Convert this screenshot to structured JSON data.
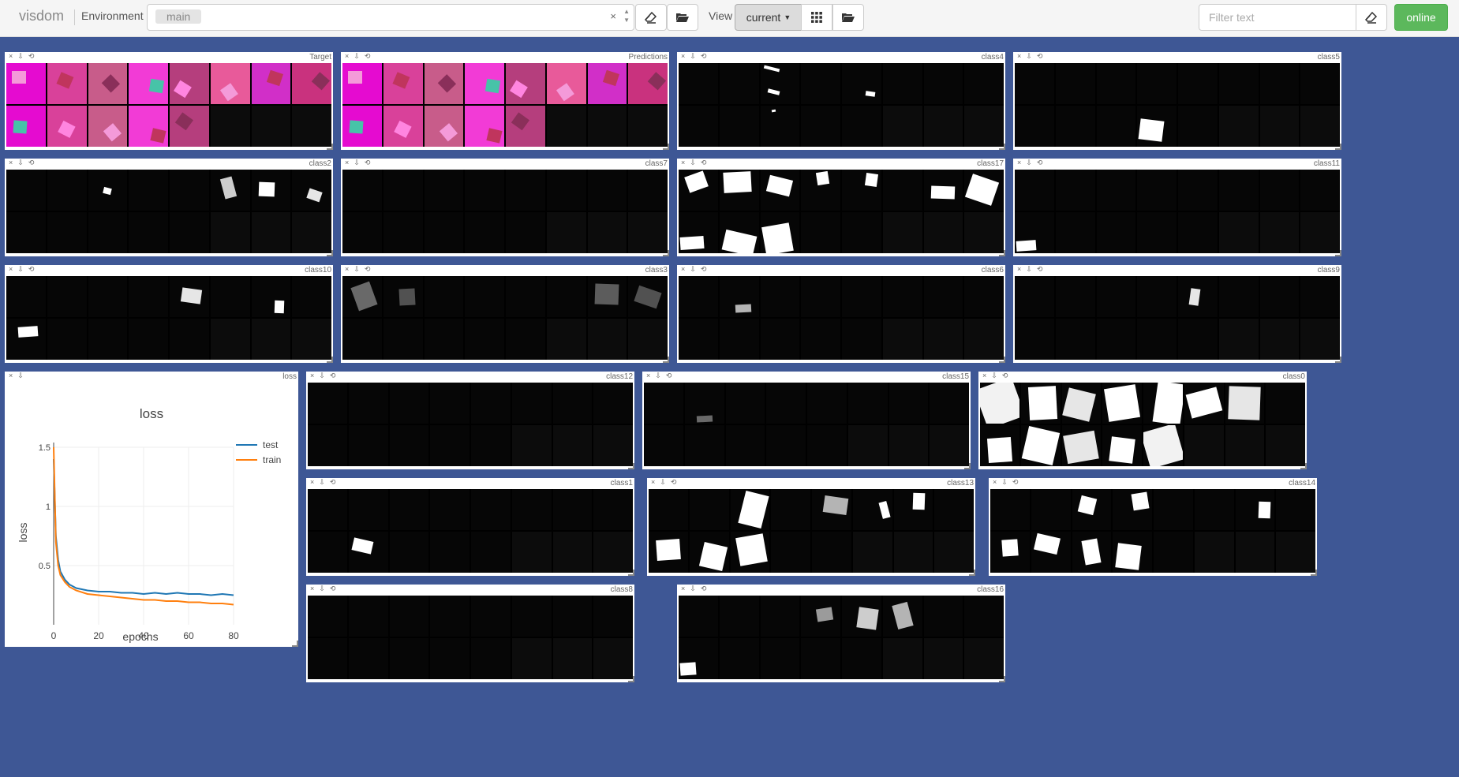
{
  "navbar": {
    "brand": "visdom",
    "environment_label": "Environment",
    "environment_value": "main",
    "environment_clear": "×",
    "view_label": "View",
    "view_value": "current",
    "filter_placeholder": "Filter text",
    "status_label": "online"
  },
  "panes": {
    "target": {
      "title": "Target"
    },
    "predictions": {
      "title": "Predictions"
    },
    "class4": {
      "title": "class4"
    },
    "class5": {
      "title": "class5"
    },
    "class2": {
      "title": "class2"
    },
    "class7": {
      "title": "class7"
    },
    "class17": {
      "title": "class17"
    },
    "class11": {
      "title": "class11"
    },
    "class10": {
      "title": "class10"
    },
    "class3": {
      "title": "class3"
    },
    "class6": {
      "title": "class6"
    },
    "class9": {
      "title": "class9"
    },
    "loss": {
      "title": "loss"
    },
    "class12": {
      "title": "class12"
    },
    "class15": {
      "title": "class15"
    },
    "class0": {
      "title": "class0"
    },
    "class1": {
      "title": "class1"
    },
    "class13": {
      "title": "class13"
    },
    "class14": {
      "title": "class14"
    },
    "class8": {
      "title": "class8"
    },
    "class16": {
      "title": "class16"
    }
  },
  "chart_data": {
    "type": "line",
    "title": "loss",
    "xlabel": "epochs",
    "ylabel": "loss",
    "xlim": [
      0,
      80
    ],
    "ylim": [
      0,
      1.5
    ],
    "x_ticks": [
      "0",
      "20",
      "40",
      "60",
      "80"
    ],
    "y_ticks": [
      "0.5",
      "1",
      "1.5"
    ],
    "grid": true,
    "legend_position": "top-right",
    "series": [
      {
        "name": "test",
        "color": "#1f77b4",
        "x": [
          0,
          1,
          2,
          3,
          5,
          7,
          10,
          15,
          20,
          25,
          30,
          35,
          40,
          45,
          50,
          55,
          60,
          65,
          70,
          75,
          80
        ],
        "y": [
          1.4,
          0.75,
          0.55,
          0.45,
          0.38,
          0.34,
          0.31,
          0.29,
          0.28,
          0.28,
          0.27,
          0.27,
          0.26,
          0.27,
          0.26,
          0.27,
          0.26,
          0.26,
          0.25,
          0.26,
          0.25
        ]
      },
      {
        "name": "train",
        "color": "#ff7f0e",
        "x": [
          0,
          1,
          2,
          3,
          5,
          7,
          10,
          15,
          20,
          25,
          30,
          35,
          40,
          45,
          50,
          55,
          60,
          65,
          70,
          75,
          80
        ],
        "y": [
          1.5,
          0.7,
          0.5,
          0.42,
          0.36,
          0.32,
          0.29,
          0.26,
          0.25,
          0.24,
          0.23,
          0.22,
          0.21,
          0.21,
          0.2,
          0.2,
          0.19,
          0.19,
          0.18,
          0.18,
          0.17
        ]
      }
    ]
  }
}
